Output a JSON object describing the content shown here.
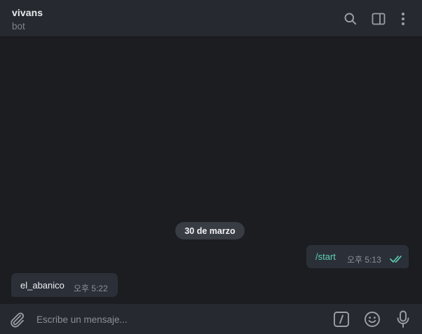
{
  "header": {
    "title": "vivans",
    "subtitle": "bot",
    "icons": [
      "search-icon",
      "sidebar-toggle-icon",
      "more-vertical-icon"
    ]
  },
  "messages": {
    "date_separator": "30 de marzo",
    "outgoing": {
      "text": "/start",
      "time": "오후 5:13",
      "status_icon": "double-check-icon"
    },
    "incoming": {
      "text": "el_abanico",
      "time": "오후 5:22"
    }
  },
  "composer": {
    "placeholder": "Escribe un mensaje...",
    "icons": [
      "attach-icon",
      "commands-icon",
      "emoji-icon",
      "microphone-icon"
    ]
  },
  "colors": {
    "background": "#1c1d21",
    "panel": "#26292f",
    "bubble": "#2b3038",
    "accent": "#5fd0b6",
    "icon": "#9aa0a8"
  }
}
